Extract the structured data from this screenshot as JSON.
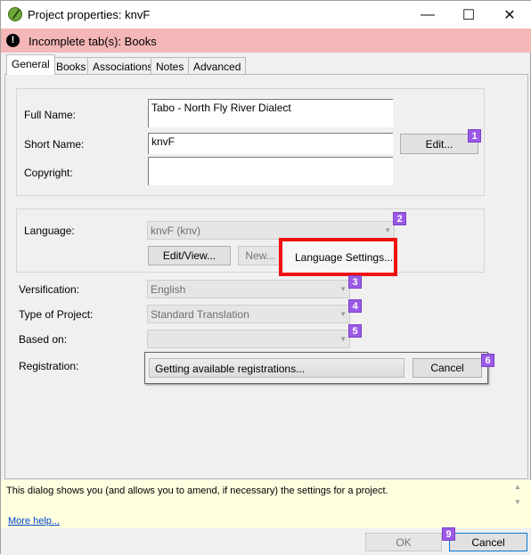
{
  "window": {
    "title": "Project properties: knvF",
    "minimize": "—",
    "maximize": "☐",
    "close": "✕"
  },
  "warning": {
    "icon_glyph": "!",
    "text": "Incomplete tab(s): Books"
  },
  "tabs": [
    {
      "label": "General",
      "active": true
    },
    {
      "label": "Books"
    },
    {
      "label": "Associations"
    },
    {
      "label": "Notes"
    },
    {
      "label": "Advanced"
    }
  ],
  "names": {
    "full_name_label": "Full Name:",
    "full_name_value": "Tabo - North Fly River Dialect",
    "short_name_label": "Short Name:",
    "short_name_value": "knvF",
    "copyright_label": "Copyright:",
    "copyright_value": "",
    "edit_button": "Edit..."
  },
  "language": {
    "label": "Language:",
    "value": "knvF (knv)",
    "edit_view_button": "Edit/View...",
    "new_button": "New...",
    "settings_button": "Language Settings..."
  },
  "versification": {
    "label": "Versification:",
    "value": "English"
  },
  "project_type": {
    "label": "Type of Project:",
    "value": "Standard Translation"
  },
  "based_on": {
    "label": "Based on:",
    "value": ""
  },
  "registration": {
    "label": "Registration:",
    "progress_text": "Getting available registrations...",
    "cancel_button": "Cancel"
  },
  "badges": [
    "1",
    "2",
    "3",
    "4",
    "5",
    "6",
    "9"
  ],
  "help": {
    "text": "This dialog shows you (and allows you to amend, if necessary) the settings for a project.",
    "more_link": "More help..."
  },
  "footer": {
    "ok_button": "OK",
    "cancel_button": "Cancel"
  },
  "colors": {
    "warning_bg": "#f4b6b6",
    "badge": "#9b59e6",
    "highlight_border": "#ee1111",
    "help_bg": "#ffffe0"
  }
}
